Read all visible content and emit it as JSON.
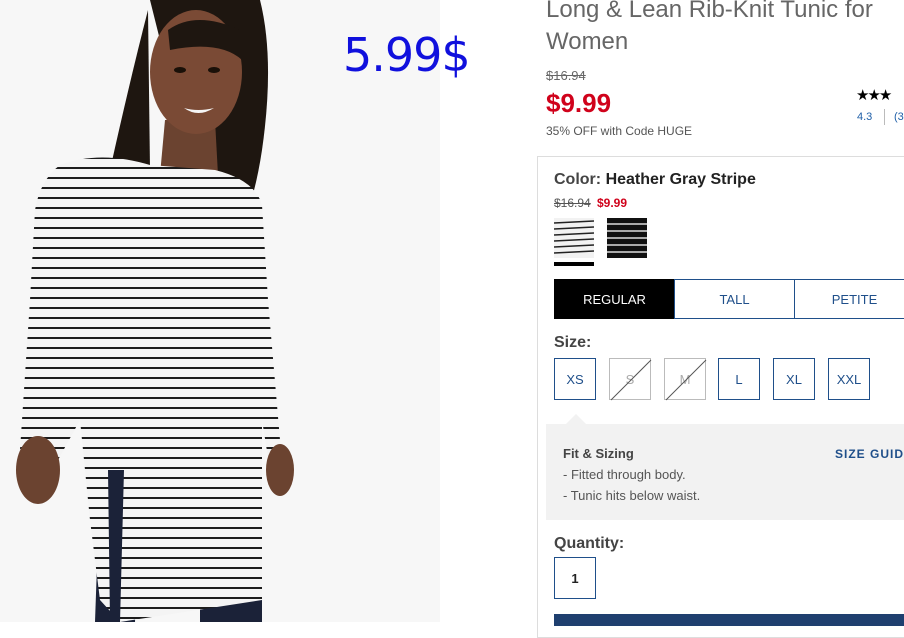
{
  "overlay_price": "5.99$",
  "product": {
    "title_line1": "Long & Lean Rib-Knit Tunic for",
    "title_line2": "Women",
    "old_price": "$16.94",
    "sale_price": "$9.99",
    "promo": "35% OFF with Code HUGE",
    "stars": "★★★",
    "rating": "4.3",
    "review_count": "(3"
  },
  "color": {
    "label": "Color:",
    "value": "Heather Gray Stripe",
    "old_price": "$16.94",
    "new_price": "$9.99",
    "swatches": [
      "heather-gray-stripe",
      "black-stripe"
    ]
  },
  "fit_tabs": [
    {
      "label": "REGULAR",
      "active": true
    },
    {
      "label": "TALL",
      "active": false
    },
    {
      "label": "PETITE",
      "active": false
    }
  ],
  "size": {
    "label": "Size:",
    "options": [
      {
        "label": "XS",
        "available": true
      },
      {
        "label": "S",
        "available": false
      },
      {
        "label": "M",
        "available": false
      },
      {
        "label": "L",
        "available": true
      },
      {
        "label": "XL",
        "available": true
      },
      {
        "label": "XXL",
        "available": true
      }
    ]
  },
  "fit_sizing": {
    "title": "Fit & Sizing",
    "lines": [
      "- Fitted through body.",
      "- Tunic hits below waist."
    ],
    "size_guide": "SIZE GUID"
  },
  "quantity": {
    "label": "Quantity:",
    "value": "1"
  },
  "colors": {
    "sale_red": "#d0021b",
    "link_blue": "#1f4f8a",
    "overlay_blue": "#1010dd"
  }
}
